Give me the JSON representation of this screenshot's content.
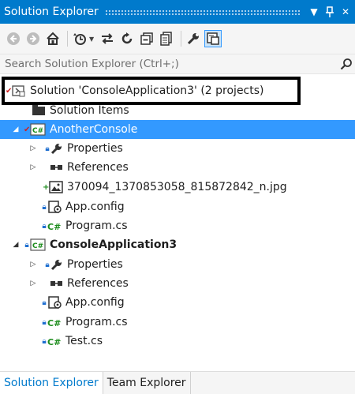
{
  "window": {
    "title": "Solution Explorer"
  },
  "toolbar": {
    "buttons": [
      "back-icon",
      "forward-icon",
      "home-icon",
      "history-icon",
      "sync-icon",
      "refresh-icon",
      "collapse-all-icon",
      "show-all-files-icon",
      "properties-icon",
      "preview-icon"
    ]
  },
  "search": {
    "placeholder": "Search Solution Explorer (Ctrl+;)"
  },
  "tree": {
    "solution": {
      "label": "Solution 'ConsoleApplication3' (2 projects)"
    },
    "solution_items": {
      "label": "Solution Items"
    },
    "project1": {
      "label": "AnotherConsole",
      "properties": "Properties",
      "references": "References",
      "image_file": "370094_1370853058_815872842_n.jpg",
      "app_config": "App.config",
      "program": "Program.cs"
    },
    "project2": {
      "label": "ConsoleApplication3",
      "properties": "Properties",
      "references": "References",
      "app_config": "App.config",
      "program": "Program.cs",
      "test": "Test.cs"
    }
  },
  "tabs": [
    {
      "label": "Solution Explorer",
      "active": true
    },
    {
      "label": "Team Explorer",
      "active": false
    }
  ],
  "colors": {
    "accent": "#007acc",
    "selection": "#3399ff",
    "csharp_green": "#1c8c1c",
    "lock_blue": "#1f6fd0",
    "check_red": "#d02020"
  }
}
